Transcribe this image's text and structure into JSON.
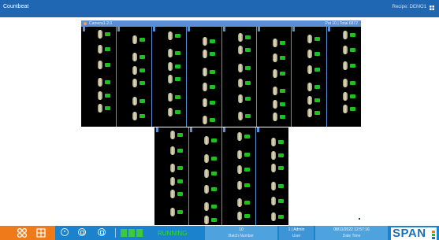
{
  "app": {
    "title": "Countbeat",
    "recipe": "Recipe: DEMO1"
  },
  "camera": {
    "name": "Camera1-2.0",
    "frame_info": "Pat 10 | Total 6872"
  },
  "status": {
    "running_label": "RUNNING"
  },
  "fields": [
    {
      "value": "10",
      "label": "Batch Number"
    },
    {
      "value": "1 | Admin",
      "label": "User"
    },
    {
      "value": "08/11/2022 12:57:16",
      "label": "Date Time"
    }
  ],
  "logo": {
    "text": "SPAN"
  },
  "icons": [
    "grid-icon",
    "settings-icon",
    "layout-icon",
    "play-icon",
    "pause-icon",
    "stop-icon"
  ],
  "colors": {
    "titlebar": "#1f66b3",
    "accent_orange": "#ef7a1a",
    "status_green": "#3cc93c",
    "bottombar": "#1b82cd"
  }
}
